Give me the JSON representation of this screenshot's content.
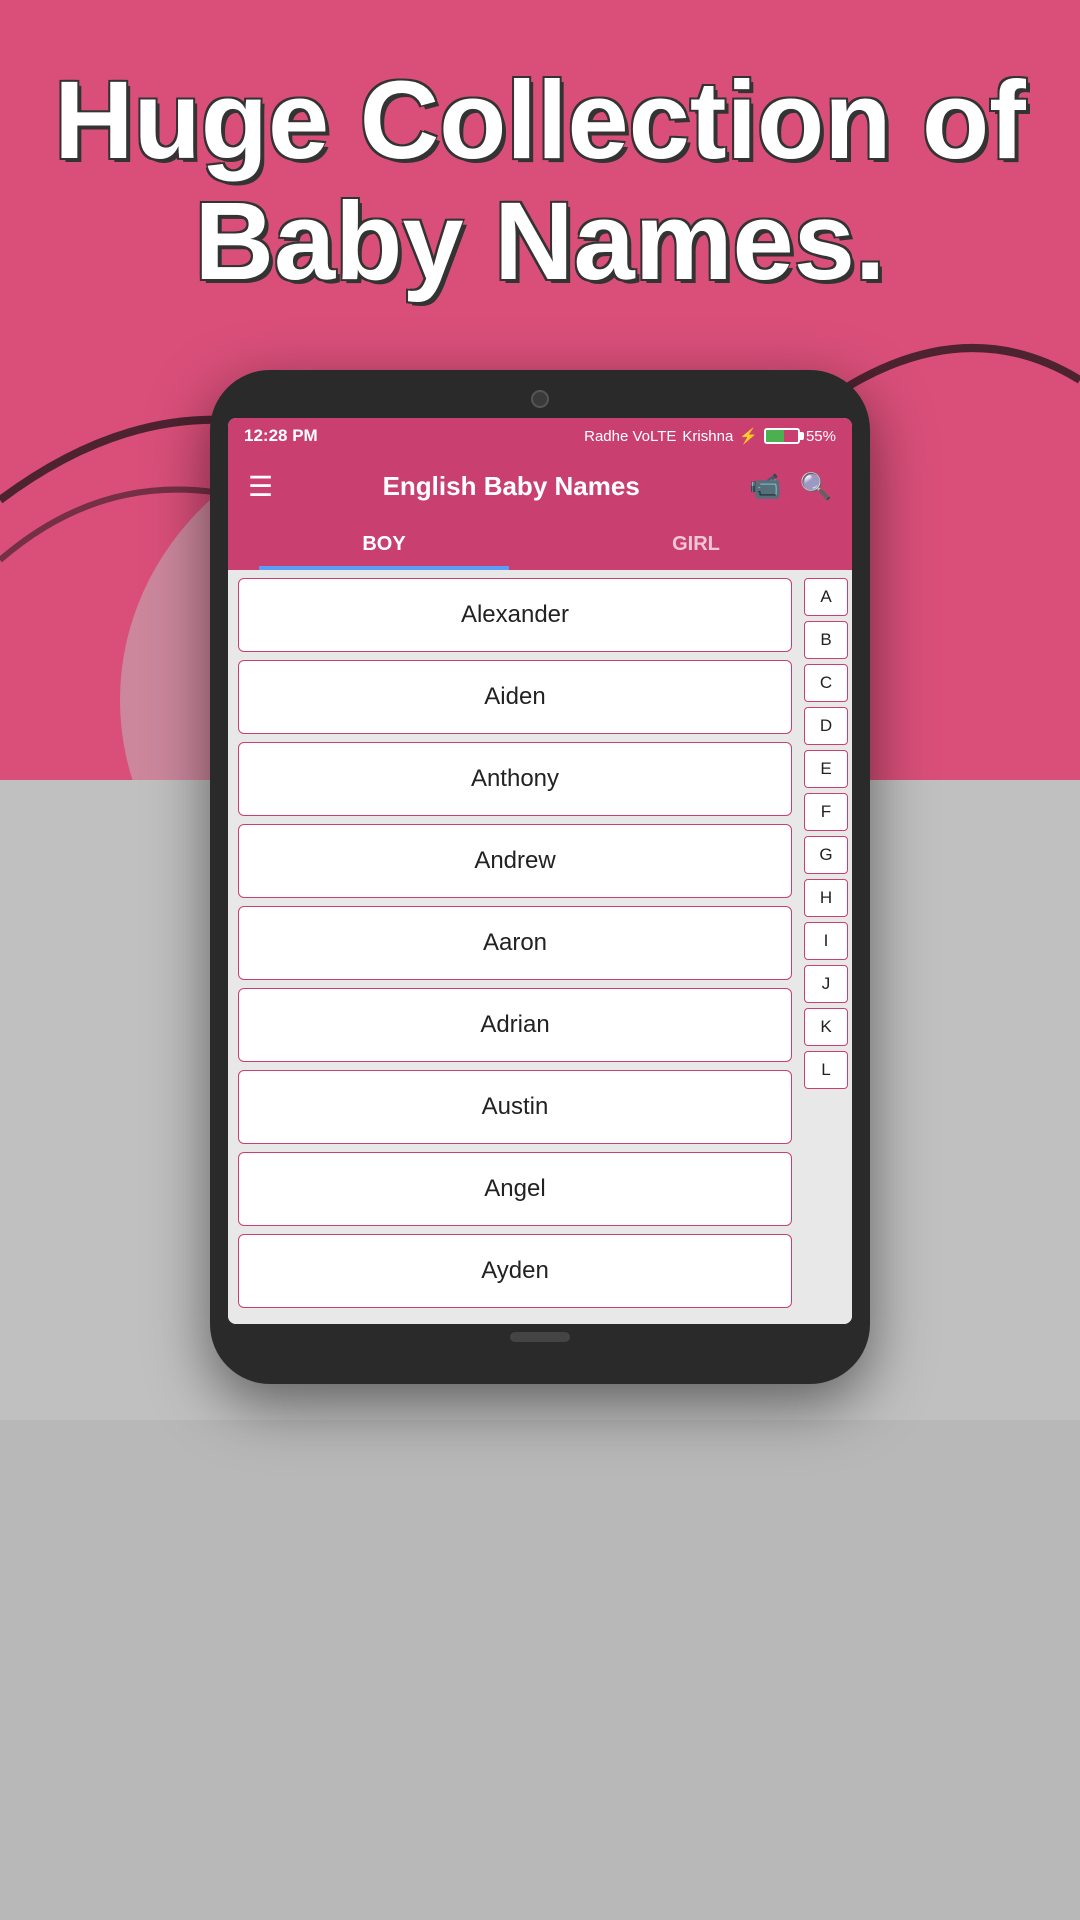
{
  "background": {
    "hero_color": "#d94f7a",
    "bottom_color": "#b8b8b8"
  },
  "hero": {
    "line1": "Huge Collection of",
    "line2": "Baby Names."
  },
  "status_bar": {
    "time": "12:28 PM",
    "carrier1": "Radhe VoLTE",
    "carrier2": "Krishna",
    "battery": "55%",
    "bolt": "⚡"
  },
  "app_bar": {
    "title": "English Baby Names",
    "menu_icon": "☰",
    "video_icon": "📹",
    "search_icon": "🔍"
  },
  "tabs": [
    {
      "label": "BOY",
      "active": true
    },
    {
      "label": "GIRL",
      "active": false
    }
  ],
  "names": [
    "Alexander",
    "Aiden",
    "Anthony",
    "Andrew",
    "Aaron",
    "Adrian",
    "Austin",
    "Angel",
    "Ayden"
  ],
  "alphabet": [
    "A",
    "B",
    "C",
    "D",
    "E",
    "F",
    "G",
    "H",
    "I",
    "J",
    "K",
    "L"
  ]
}
